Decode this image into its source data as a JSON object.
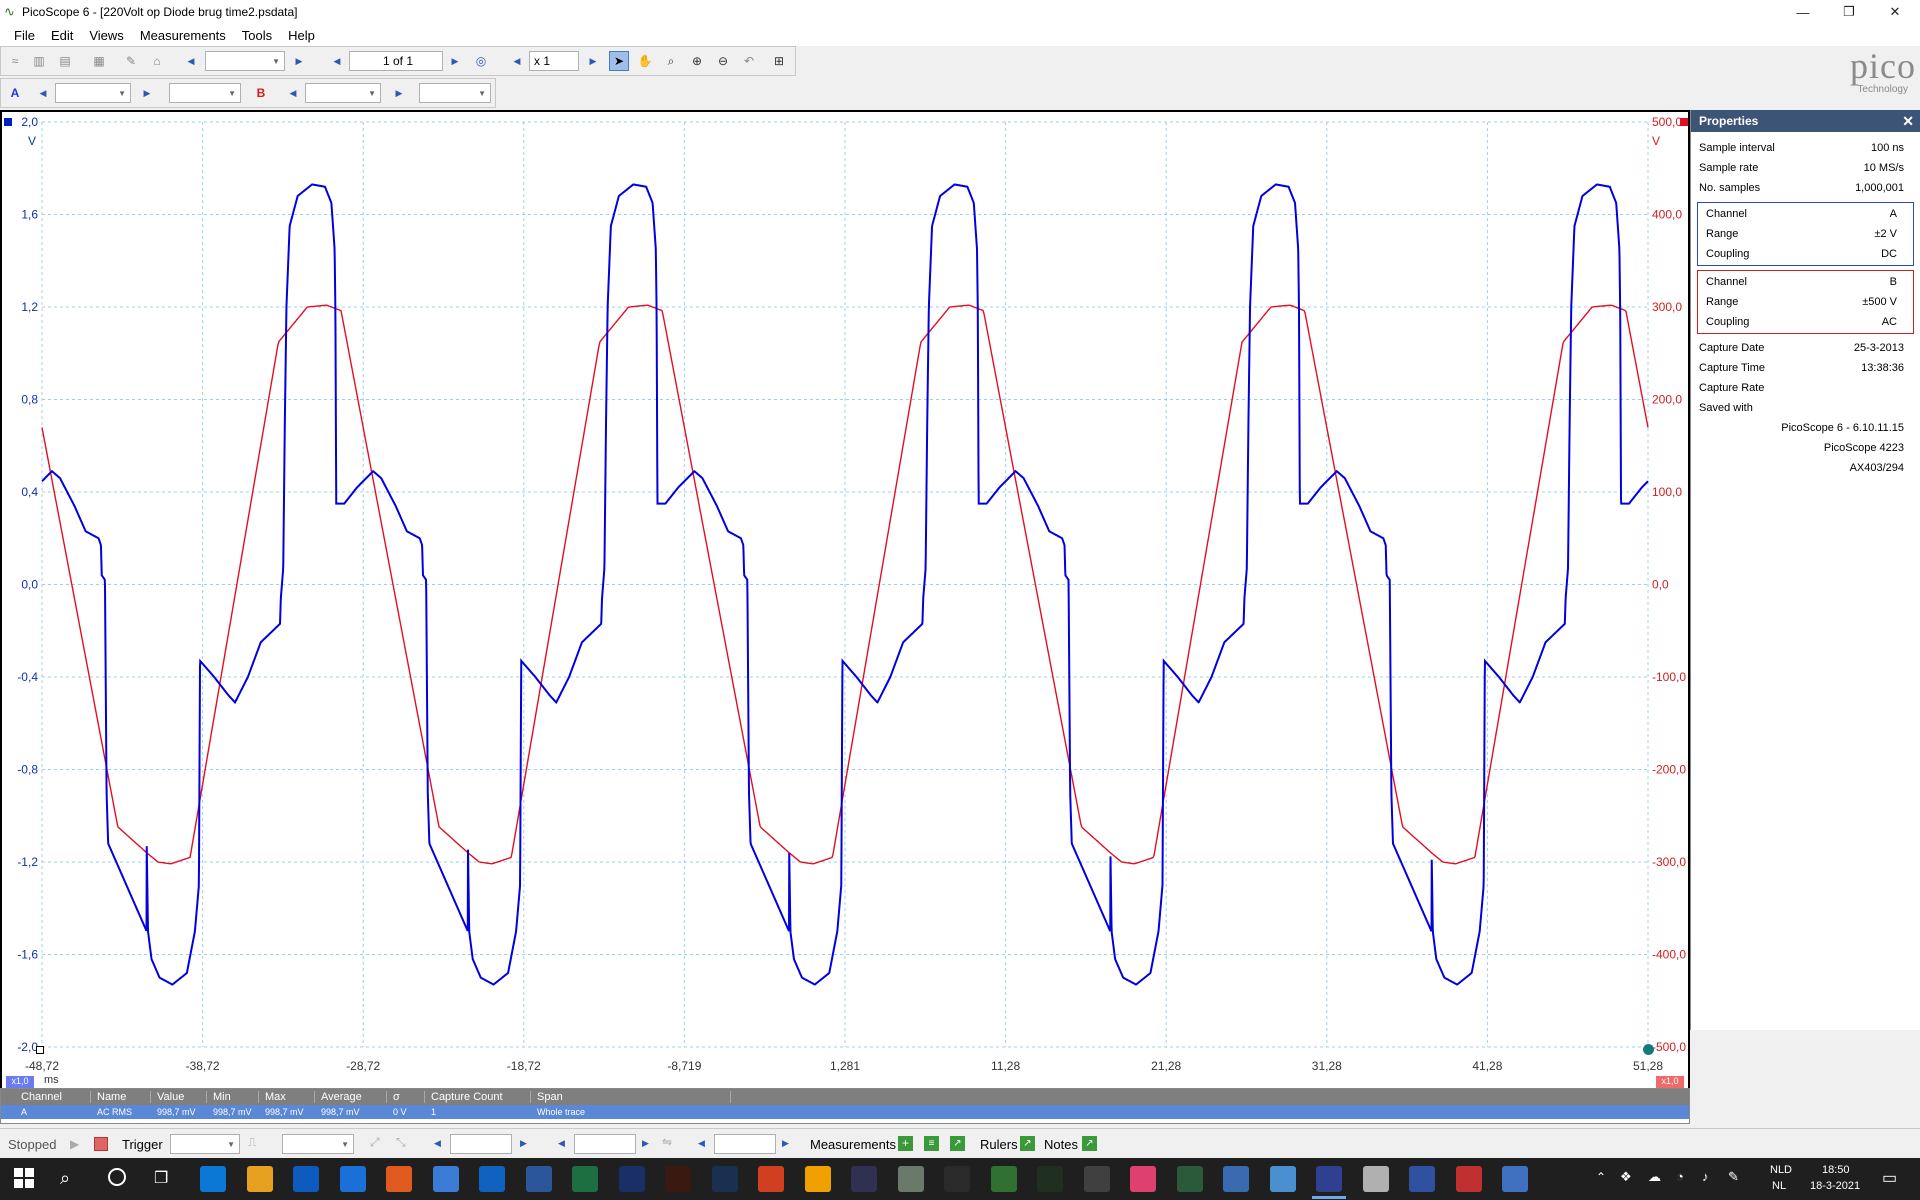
{
  "window": {
    "title": "PicoScope 6 - [220Volt op Diode brug time2.psdata]"
  },
  "menu": [
    "File",
    "Edit",
    "Views",
    "Measurements",
    "Tools",
    "Help"
  ],
  "toolbar": {
    "page": "1 of 1",
    "zoom": "x 1"
  },
  "channel_bar": {
    "a": "A",
    "b": "B"
  },
  "logo": {
    "brand": "pico",
    "sub": "Technology"
  },
  "plot": {
    "left_axis": {
      "ticks": [
        "2,0",
        "1,6",
        "1,2",
        "0,8",
        "0,4",
        "0,0",
        "-0,4",
        "-0,8",
        "-1,2",
        "-1,6",
        "-2,0"
      ],
      "unit": "V"
    },
    "right_axis": {
      "ticks": [
        "500,0",
        "400,0",
        "300,0",
        "200,0",
        "100,0",
        "0,0",
        "-100,0",
        "-200,0",
        "-300,0",
        "-400,0",
        "-500,0"
      ],
      "unit": "V"
    },
    "x_axis": {
      "ticks": [
        "-48,72",
        "-38,72",
        "-28,72",
        "-18,72",
        "-8,719",
        "1,281",
        "11,28",
        "21,28",
        "31,28",
        "41,28",
        "51,28"
      ],
      "unit": "ms",
      "zoom_left": "x1,0",
      "zoom_right": "x1,0"
    }
  },
  "chart_data": {
    "type": "line",
    "x_range_ms": [
      -48.72,
      51.28
    ],
    "period_ms": 20,
    "series": [
      {
        "channel": "A",
        "color": "#0000e0",
        "ylim": [
          -2,
          2
        ],
        "unit": "V",
        "peak": 1.73,
        "trough": -1.73
      },
      {
        "channel": "B",
        "color": "#e01020",
        "ylim": [
          -500,
          500
        ],
        "unit": "V",
        "peak": 302,
        "trough": -302
      }
    ]
  },
  "properties": {
    "title": "Properties",
    "rows": [
      [
        "Sample interval",
        "100 ns"
      ],
      [
        "Sample rate",
        "10 MS/s"
      ],
      [
        "No. samples",
        "1,000,001"
      ]
    ],
    "channel_a": [
      [
        "Channel",
        "A"
      ],
      [
        "Range",
        "±2 V"
      ],
      [
        "Coupling",
        "DC"
      ]
    ],
    "channel_b": [
      [
        "Channel",
        "B"
      ],
      [
        "Range",
        "±500 V"
      ],
      [
        "Coupling",
        "AC"
      ]
    ],
    "capture": [
      [
        "Capture Date",
        "25-3-2013"
      ],
      [
        "Capture Time",
        "13:38:36"
      ],
      [
        "Capture Rate",
        ""
      ],
      [
        "Saved with",
        ""
      ]
    ],
    "saved_lines": [
      "PicoScope 6 - 6.10.11.15",
      "PicoScope 4223",
      "AX403/294"
    ]
  },
  "measurements": {
    "headers": [
      "Channel",
      "Name",
      "Value",
      "Min",
      "Max",
      "Average",
      "σ",
      "Capture Count",
      "Span"
    ],
    "row": [
      "A",
      "AC RMS",
      "998,7 mV",
      "998,7 mV",
      "998,7 mV",
      "998,7 mV",
      "0 V",
      "1",
      "Whole trace"
    ]
  },
  "status": {
    "state": "Stopped",
    "trigger": "Trigger",
    "measurements": "Measurements",
    "rulers": "Rulers",
    "notes": "Notes"
  },
  "taskbar": {
    "lang1": "NLD",
    "lang2": "NL",
    "time": "18:50",
    "date": "18-3-2021"
  },
  "colors": {
    "channel_a": "#0000e0",
    "channel_b": "#e01020",
    "props_header": "#3c5476"
  }
}
